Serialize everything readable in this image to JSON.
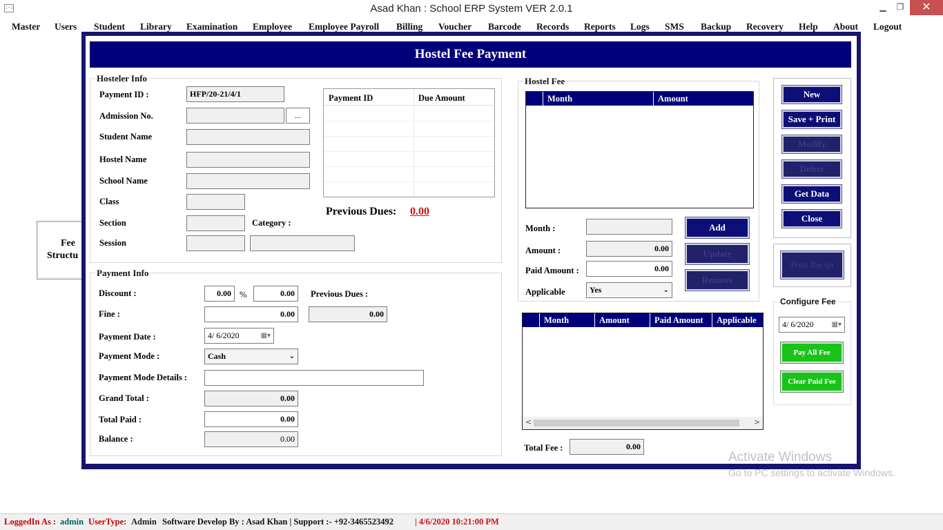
{
  "window": {
    "title": "Asad Khan : School ERP System VER 2.0.1",
    "minimize": "▁",
    "restore": "❐",
    "close": "✕",
    "app_icon": ":-:"
  },
  "menu": [
    "Master",
    "Users",
    "Student",
    "Library",
    "Examination",
    "Employee",
    "Employee Payroll",
    "Billing",
    "Voucher",
    "Barcode",
    "Records",
    "Reports",
    "Logs",
    "SMS",
    "Backup",
    "Recovery",
    "Help",
    "About",
    "Logout"
  ],
  "background_panel": {
    "line1": "Fee",
    "line2": "Structu"
  },
  "form": {
    "title": "Hostel Fee Payment",
    "hosteler_info": {
      "legend": "Hosteler Info",
      "payment_id_label": "Payment ID :",
      "payment_id_value": "HFP/20-21/4/1",
      "admission_label": "Admission No.",
      "admission_value": "",
      "browse_label": "...",
      "student_name_label": "Student Name",
      "hostel_name_label": "Hostel Name",
      "school_name_label": "School Name",
      "class_label": "Class",
      "section_label": "Section",
      "category_label": "Category :",
      "session_label": "Session",
      "dues_grid": {
        "columns": [
          "Payment ID",
          "Due Amount"
        ]
      },
      "previous_dues_label": "Previous Dues:",
      "previous_dues_value": "0.00"
    },
    "payment_info": {
      "legend": "Payment Info",
      "discount_label": "Discount :",
      "discount_value": "0.00",
      "percent_sign": "%",
      "discount_percent_value": "0.00",
      "previous_dues_label": "Previous Dues :",
      "previous_dues_value": "0.00",
      "fine_label": "Fine :",
      "fine_value": "0.00",
      "payment_date_label": "Payment Date :",
      "payment_date_value": "4/  6/2020",
      "payment_mode_label": "Payment Mode :",
      "payment_mode_value": "Cash",
      "payment_mode_details_label": "Payment Mode Details :",
      "grand_total_label": "Grand Total :",
      "grand_total_value": "0.00",
      "total_paid_label": "Total Paid :",
      "total_paid_value": "0.00",
      "balance_label": "Balance :",
      "balance_value": "0.00"
    },
    "hostel_fee": {
      "legend": "Hostel Fee",
      "grid_columns": [
        "Month",
        "Amount"
      ],
      "month_label": "Month :",
      "amount_label": "Amount :",
      "amount_value": "0.00",
      "paid_amount_label": "Paid Amount :",
      "paid_amount_value": "0.00",
      "applicable_label": "Applicable",
      "applicable_value": "Yes",
      "add_button": "Add",
      "update_button": "Update",
      "remove_button": "Remove",
      "lower_grid_columns": [
        "Month",
        "Amount",
        "Paid Amount",
        "Applicable"
      ],
      "scroll_left": "<",
      "scroll_right": ">",
      "total_fee_label": "Total Fee :",
      "total_fee_value": "0.00"
    },
    "actions": {
      "new": "New",
      "save_print": "Save + Print",
      "modify": "Modify",
      "delete": "Delete",
      "get_data": "Get Data",
      "close": "Close",
      "print_receipt": "Print Recipt"
    },
    "configure_fee": {
      "legend": "Configure Fee",
      "date_value": "4/  6/2020",
      "pay_all": "Pay All Fee",
      "clear_paid": "Clear Paid Fee"
    }
  },
  "watermark": {
    "line1": "Activate Windows",
    "line2": "Go to PC settings to activate Windows."
  },
  "status": {
    "logged_label": "LoggedIn As :",
    "logged_value": "admin",
    "usertype_label": "UserType:",
    "usertype_value": "Admin",
    "dev_text": "Software Develop By : Asad Khan | Support :-  +92-3465523492",
    "datetime": "|  4/6/2020 10:21:00 PM"
  },
  "colors": {
    "navy": "#00007a",
    "frame": "#15156e",
    "green": "#19c419",
    "red": "#d01010",
    "status_label_red": "#c00000",
    "status_value_teal": "#006060"
  }
}
